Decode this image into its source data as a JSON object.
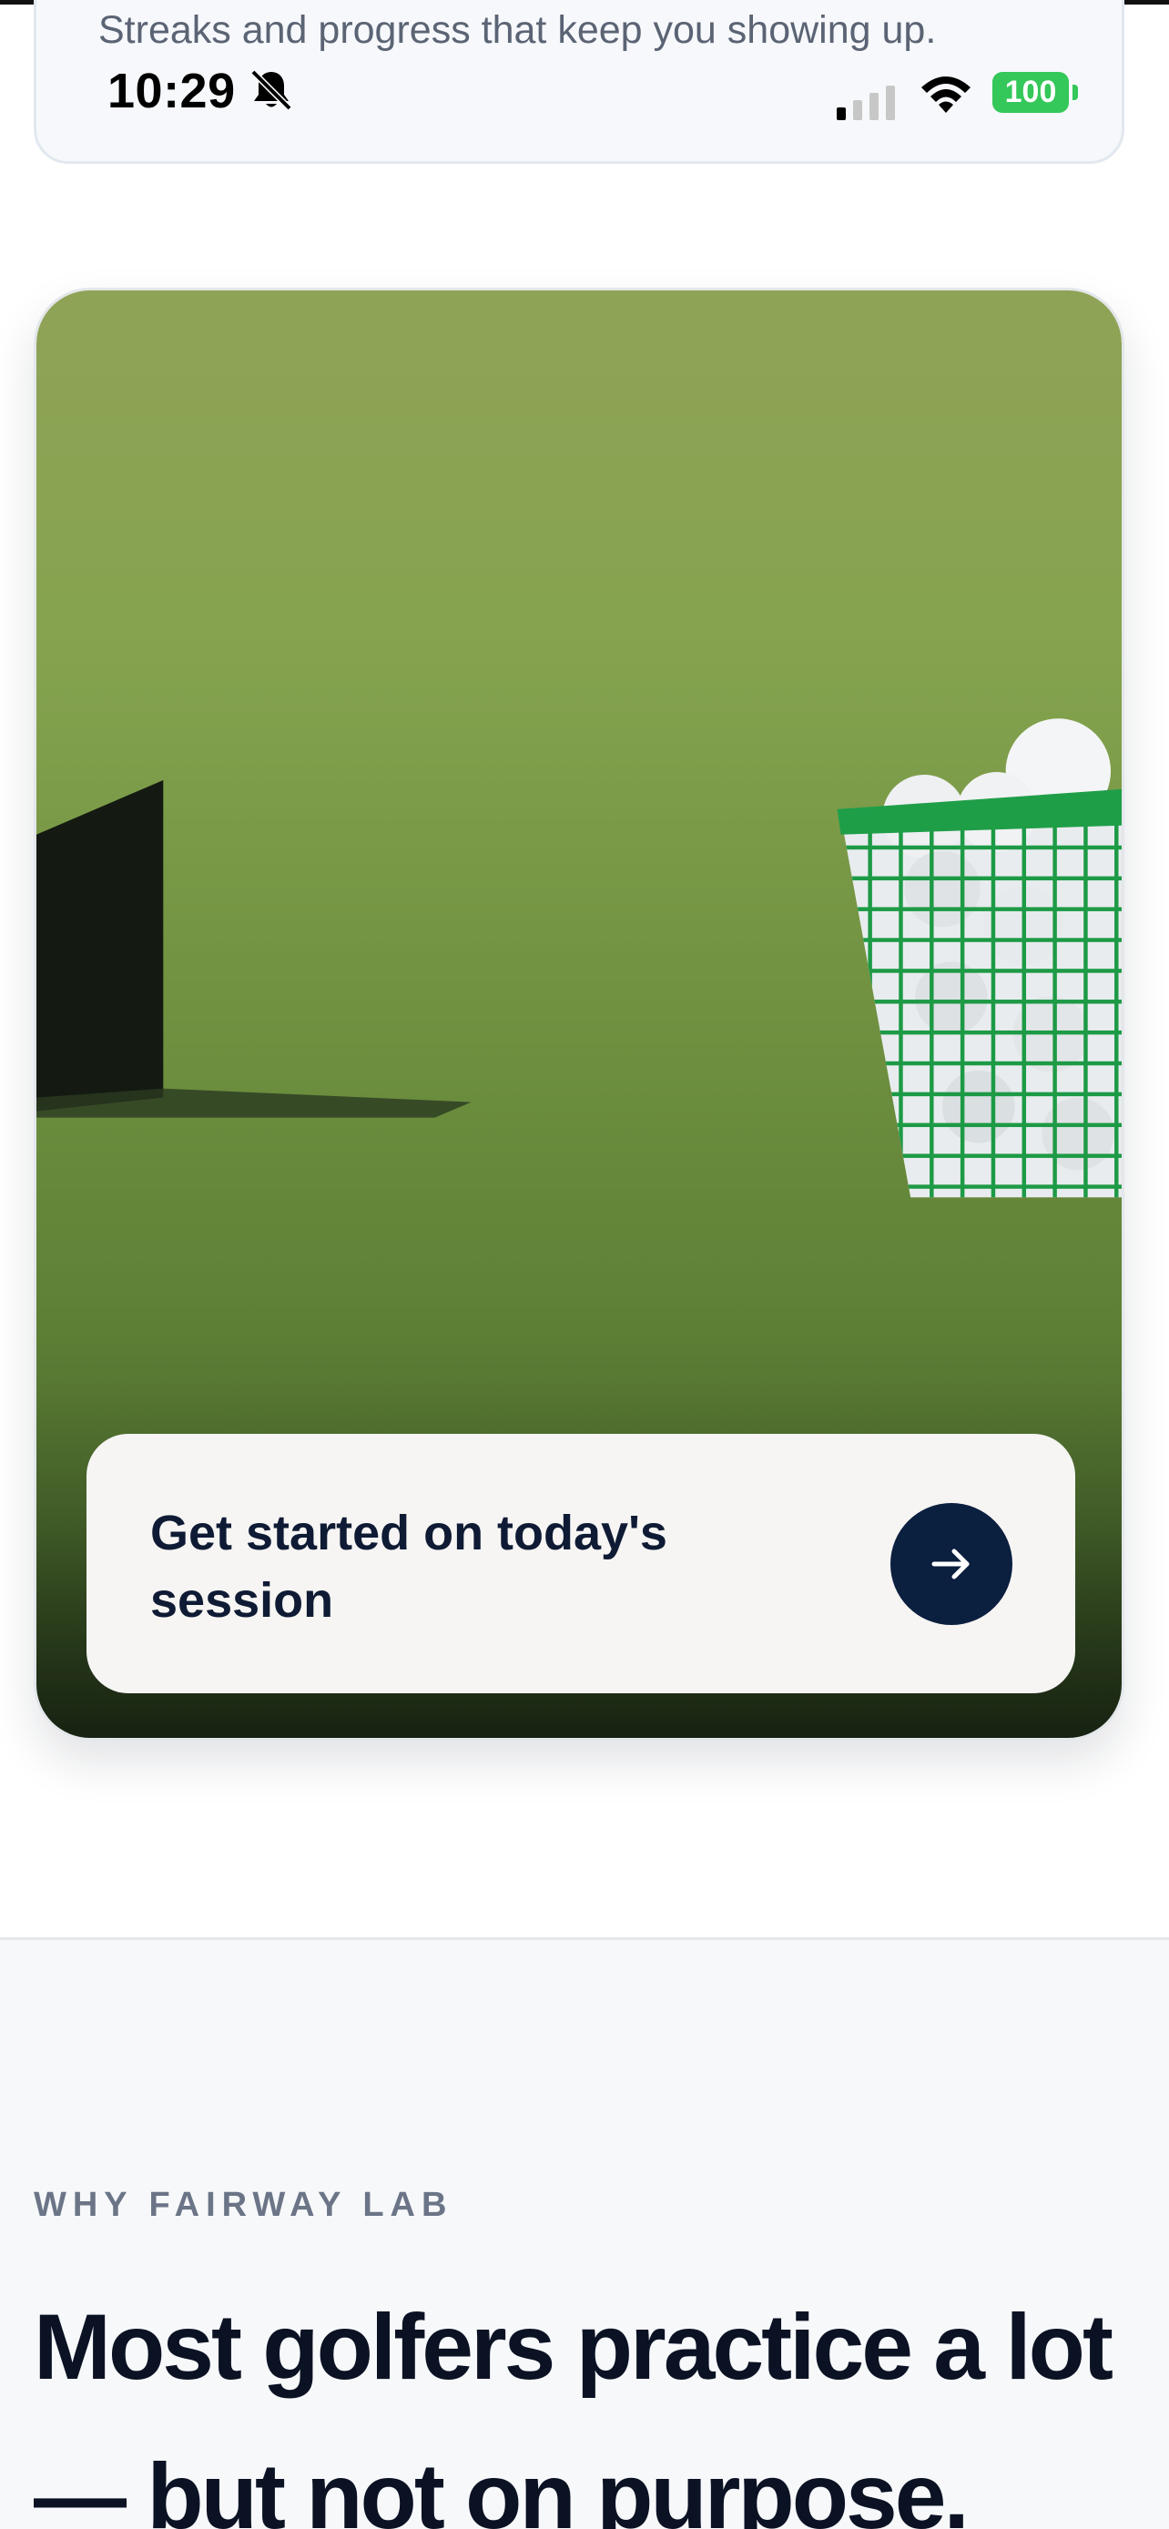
{
  "status_bar": {
    "time": "10:29",
    "battery_level": "100",
    "icons": [
      "bell-slash-icon",
      "cellular-signal-icon",
      "wifi-icon",
      "battery-icon"
    ],
    "battery_color": "#34c759"
  },
  "previous_card": {
    "subtitle": "Streaks and progress that keep you showing up."
  },
  "hero": {
    "image_description_icon": "golf-range-photo",
    "cta_label": "Get started on today's session",
    "cta_icon": "arrow-right-icon",
    "cta_button_color": "#0b1f3f"
  },
  "why_section": {
    "eyebrow": "WHY FAIRWAY LAB",
    "heading": "Most golfers practice a lot — but not on purpose."
  }
}
